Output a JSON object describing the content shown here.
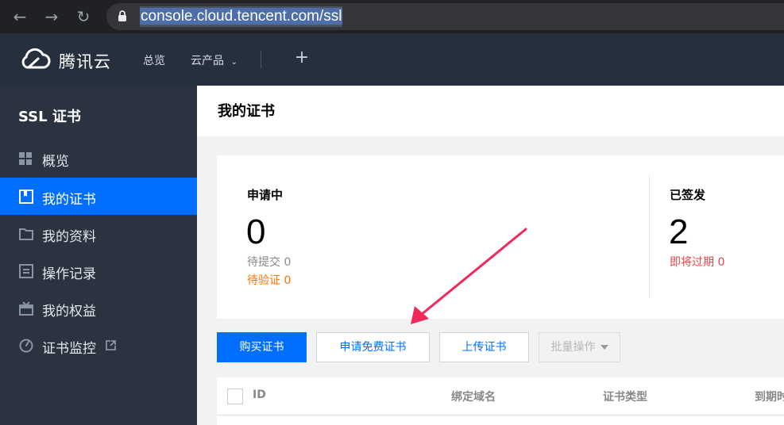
{
  "browser": {
    "url": "console.cloud.tencent.com/ssl"
  },
  "top_nav": {
    "logo_text": "腾讯云",
    "links": [
      {
        "label": "总览"
      },
      {
        "label": "云产品"
      }
    ]
  },
  "sidebar": {
    "title": "SSL 证书",
    "items": [
      {
        "label": "概览",
        "icon": "grid-icon",
        "active": false
      },
      {
        "label": "我的证书",
        "icon": "certificate-icon",
        "active": true
      },
      {
        "label": "我的资料",
        "icon": "folder-icon",
        "active": false
      },
      {
        "label": "操作记录",
        "icon": "record-list-icon",
        "active": false
      },
      {
        "label": "我的权益",
        "icon": "gift-icon",
        "active": false
      },
      {
        "label": "证书监控",
        "icon": "monitor-gauge-icon",
        "active": false
      }
    ]
  },
  "page": {
    "title": "我的证书"
  },
  "stats": {
    "applying": {
      "title": "申请中",
      "count": "0",
      "pending_submit": "待提交 0",
      "pending_verify": "待验证 0"
    },
    "issued": {
      "title": "已签发",
      "count": "2",
      "expiring": "即将过期 0"
    }
  },
  "actions": {
    "buy": "购买证书",
    "apply_free": "申请免费证书",
    "upload": "上传证书",
    "batch": "批量操作"
  },
  "table": {
    "columns": [
      "ID",
      "绑定域名",
      "证书类型",
      "到期时"
    ]
  },
  "colors": {
    "primary": "#006eff",
    "warning": "#ff7200",
    "danger": "#e54545",
    "annotation_arrow": "#f0295a"
  }
}
